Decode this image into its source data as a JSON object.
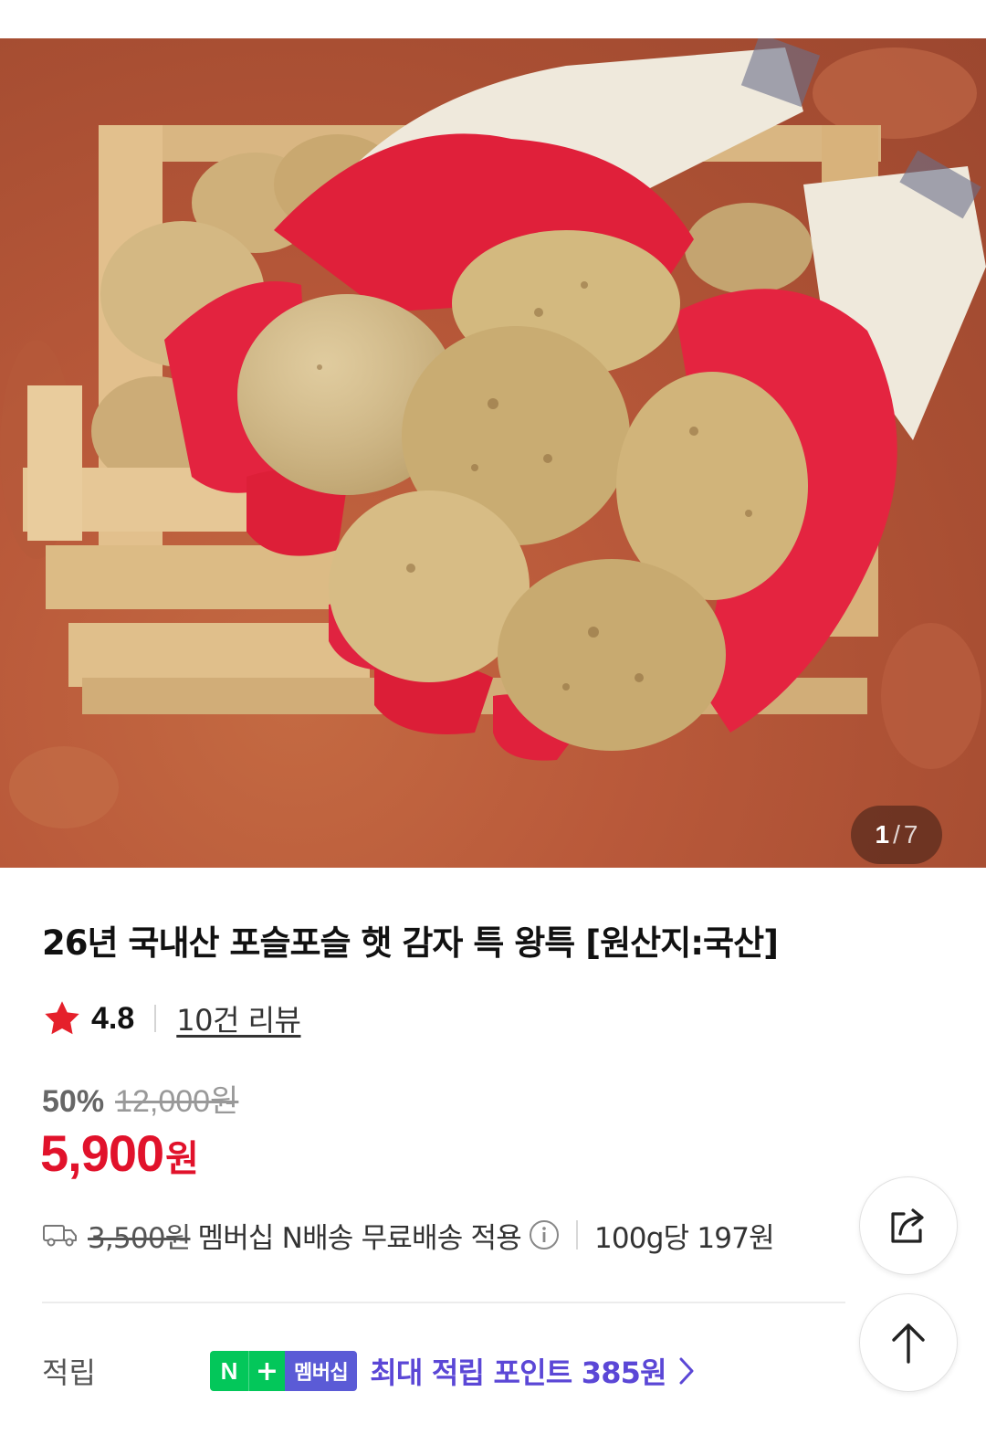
{
  "gallery": {
    "current_index": "1",
    "separator": "/",
    "total": "7",
    "image_alt": "Fresh potatoes held in red-coated work gloves above a wooden crate on red soil"
  },
  "product": {
    "title": "26년 국내산 포슬포슬 햇 감자 특 왕특 [원산지:국산]",
    "rating": "4.8",
    "review_link": "10건 리뷰",
    "discount_percent": "50%",
    "original_price": "12,000원",
    "sale_price": "5,900",
    "sale_price_unit": "원"
  },
  "shipping": {
    "original_fee": "3,500원",
    "benefit_text": "멤버십 N배송 무료배송 적용",
    "unit_price": "100g당 197원"
  },
  "points": {
    "label": "적립",
    "badge_n": "N",
    "badge_plus": "+",
    "badge_text": "멤버십",
    "max_points_text": "최대 적립 포인트 385원"
  },
  "icons": {
    "rating": "star-icon",
    "shipping": "truck-icon",
    "info": "info-icon",
    "share": "share-icon",
    "scroll_top": "arrow-up-icon",
    "more": "chevron-right-icon"
  },
  "colors": {
    "price_red": "#e1122b",
    "star_red": "#e5202b",
    "naver_green": "#03c75a",
    "points_purple": "#5b47d6"
  }
}
